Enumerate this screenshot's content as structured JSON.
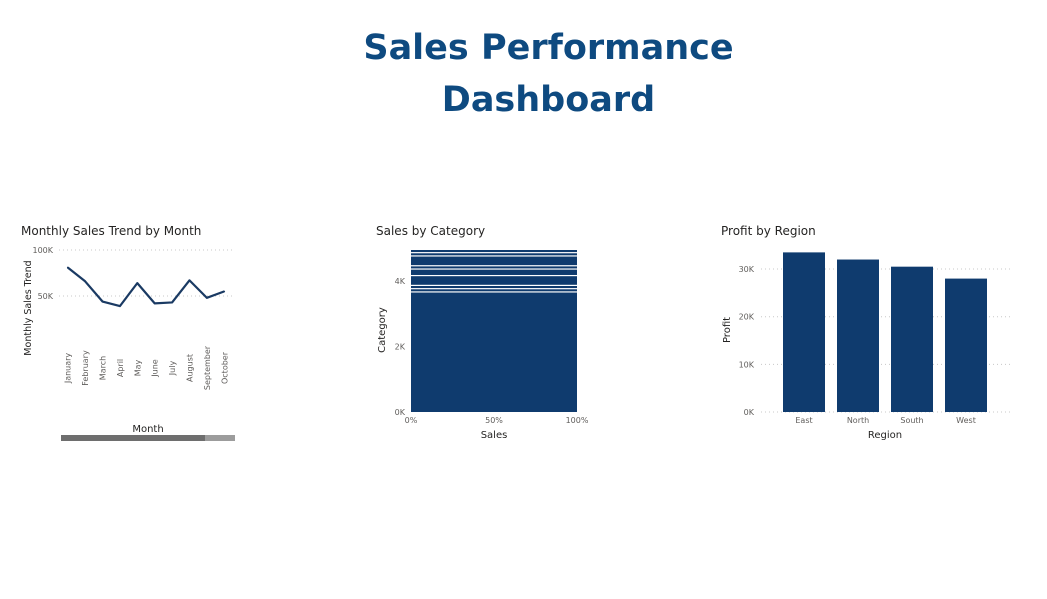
{
  "dashboard": {
    "title_line1": "Sales Performance",
    "title_line2": "Dashboard"
  },
  "colors": {
    "title": "#0e4a80",
    "bar": "#0f3b6e",
    "line": "#1a3a63",
    "scrollbar_track": "#9c9c9c",
    "scrollbar_thumb": "#6e6e6e"
  },
  "chart_data": [
    {
      "id": "monthly",
      "type": "line",
      "title": "Monthly Sales Trend by Month",
      "xlabel": "Month",
      "ylabel": "Monthly Sales Trend",
      "categories": [
        "January",
        "February",
        "March",
        "April",
        "May",
        "June",
        "July",
        "August",
        "September",
        "October"
      ],
      "values": [
        81000,
        66000,
        44000,
        39000,
        64000,
        42000,
        43000,
        67000,
        48000,
        55000
      ],
      "ylim": [
        0,
        100000
      ],
      "yticks": [
        {
          "value": 100000,
          "label": "100K"
        },
        {
          "value": 50000,
          "label": "50K"
        }
      ],
      "grid": true,
      "scrollbar": true
    },
    {
      "id": "category",
      "type": "bar",
      "orientation": "horizontal-100%-stacked",
      "title": "Sales by Category",
      "xlabel": "Sales",
      "ylabel": "Category",
      "y_values": [
        3650,
        3750,
        3850,
        4150,
        4350,
        4450,
        4750,
        4850,
        4950
      ],
      "ylim": [
        0,
        4950
      ],
      "yticks": [
        {
          "value": 0,
          "label": "0K"
        },
        {
          "value": 2000,
          "label": "2K"
        },
        {
          "value": 4000,
          "label": "4K"
        }
      ],
      "xticks": [
        {
          "value": 0,
          "label": "0%"
        },
        {
          "value": 50,
          "label": "50%"
        },
        {
          "value": 100,
          "label": "100%"
        }
      ],
      "xlim": [
        0,
        100
      ]
    },
    {
      "id": "region",
      "type": "bar",
      "title": "Profit by Region",
      "xlabel": "Region",
      "ylabel": "Profit",
      "categories": [
        "East",
        "North",
        "South",
        "West"
      ],
      "values": [
        33500,
        32000,
        30500,
        28000
      ],
      "ylim": [
        0,
        34000
      ],
      "yticks": [
        {
          "value": 0,
          "label": "0K"
        },
        {
          "value": 10000,
          "label": "10K"
        },
        {
          "value": 20000,
          "label": "20K"
        },
        {
          "value": 30000,
          "label": "30K"
        }
      ],
      "grid": true
    }
  ]
}
